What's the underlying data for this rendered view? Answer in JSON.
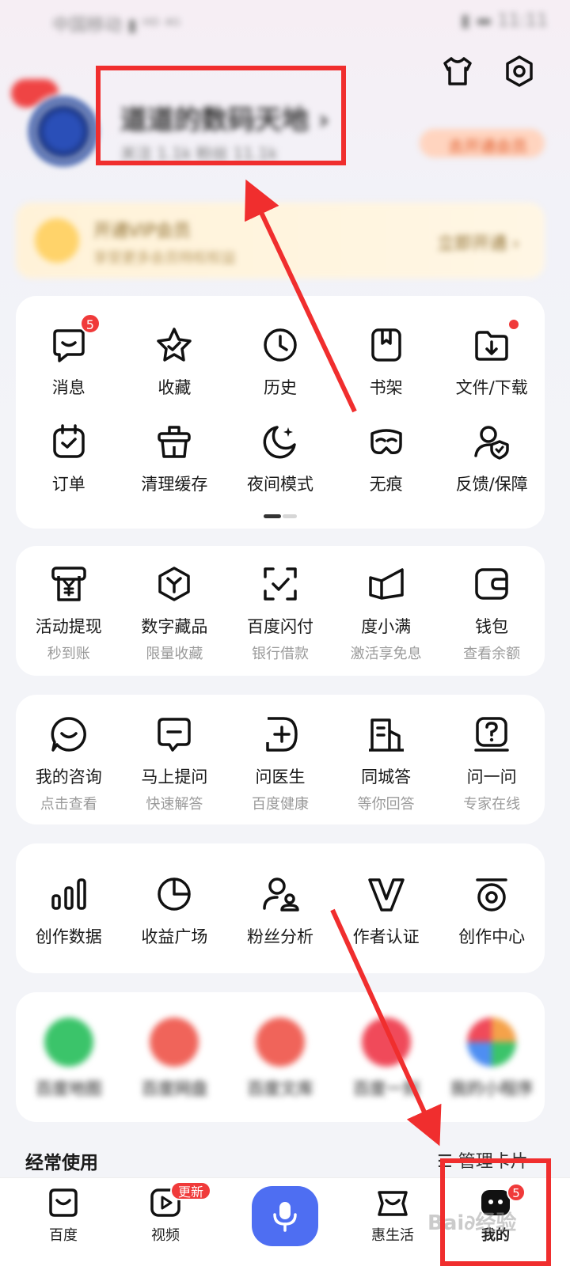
{
  "status": {
    "left": "中国移动 ▮ ᴴᴰ ⁴ᴳ",
    "right": "▮ ▬ 11:11"
  },
  "header": {
    "user_name": "道道的数码天地 ›",
    "user_sub": "关注 1.1k      粉丝 11.1k",
    "pill": "去开通会员"
  },
  "vip": {
    "title": "开通VIP会员",
    "sub": "享受更多会员特权权益",
    "button": "立即开通 ›"
  },
  "quick": [
    {
      "label": "消息",
      "icon": "message-icon",
      "badge": "5"
    },
    {
      "label": "收藏",
      "icon": "star-icon"
    },
    {
      "label": "历史",
      "icon": "clock-icon"
    },
    {
      "label": "书架",
      "icon": "bookshelf-icon"
    },
    {
      "label": "文件/下载",
      "icon": "download-folder-icon",
      "dot": true
    },
    {
      "label": "订单",
      "icon": "calendar-check-icon"
    },
    {
      "label": "清理缓存",
      "icon": "clean-cache-icon"
    },
    {
      "label": "夜间模式",
      "icon": "moon-icon"
    },
    {
      "label": "无痕",
      "icon": "mask-icon"
    },
    {
      "label": "反馈/保障",
      "icon": "user-shield-icon"
    }
  ],
  "finance": [
    {
      "label": "活动提现",
      "sub": "秒到账",
      "icon": "yuan-withdraw-icon"
    },
    {
      "label": "数字藏品",
      "sub": "限量收藏",
      "icon": "cube-icon"
    },
    {
      "label": "百度闪付",
      "sub": "银行借款",
      "icon": "scan-check-icon"
    },
    {
      "label": "度小满",
      "sub": "激活享免息",
      "icon": "duxiaoman-icon"
    },
    {
      "label": "钱包",
      "sub": "查看余额",
      "icon": "wallet-icon"
    }
  ],
  "health": [
    {
      "label": "我的咨询",
      "sub": "点击查看",
      "icon": "consult-icon"
    },
    {
      "label": "马上提问",
      "sub": "快速解答",
      "icon": "ask-icon"
    },
    {
      "label": "问医生",
      "sub": "百度健康",
      "icon": "doctor-icon"
    },
    {
      "label": "同城答",
      "sub": "等你回答",
      "icon": "building-icon"
    },
    {
      "label": "问一问",
      "sub": "专家在线",
      "icon": "question-icon"
    }
  ],
  "creator": [
    {
      "label": "创作数据",
      "icon": "bar-chart-icon"
    },
    {
      "label": "收益广场",
      "icon": "pie-chart-icon"
    },
    {
      "label": "粉丝分析",
      "icon": "fans-icon"
    },
    {
      "label": "作者认证",
      "icon": "verify-v-icon"
    },
    {
      "label": "创作中心",
      "icon": "create-center-icon"
    }
  ],
  "apps": [
    {
      "label": "百度地图",
      "color": "#3bc46a"
    },
    {
      "label": "百度网盘",
      "color": "#f0645a"
    },
    {
      "label": "百度文库",
      "color": "#f0645a"
    },
    {
      "label": "百度一刻",
      "color": "#f04a5a"
    },
    {
      "label": "我的小程序",
      "color": "#f5a24a"
    }
  ],
  "freq": {
    "title": "经常使用",
    "manage": "☰ 管理卡片"
  },
  "nav": {
    "home": "百度",
    "video": "视频",
    "video_badge": "更新",
    "life": "惠生活",
    "mine": "我的",
    "mine_badge": "5"
  },
  "watermark": "Bai∂经验",
  "colors": {
    "accent": "#4e6ef2",
    "badge": "#f03a3a",
    "annotation": "#f02e2e"
  }
}
